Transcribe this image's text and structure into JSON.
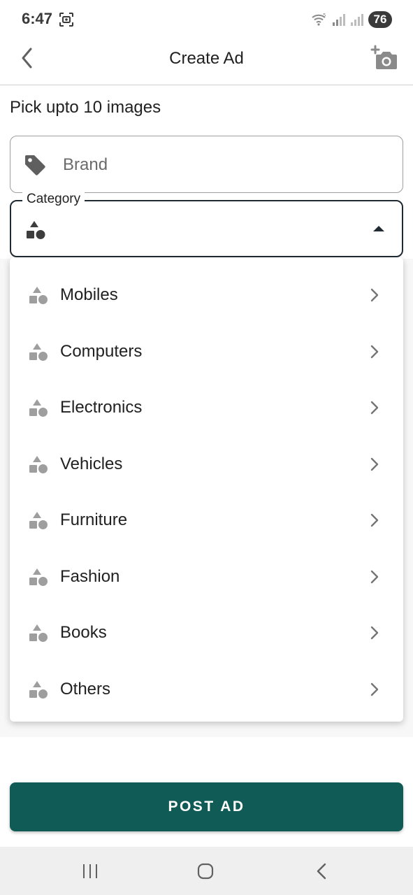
{
  "status_bar": {
    "time": "6:47",
    "battery": "76",
    "icons": [
      "screenshot-icon",
      "wifi-icon",
      "signal-icon",
      "signal-icon",
      "battery-icon"
    ]
  },
  "app_bar": {
    "title": "Create Ad",
    "back_icon": "chevron-left-icon",
    "action_icon": "add-photo-icon"
  },
  "images": {
    "label": "Pick upto 10 images"
  },
  "brand": {
    "placeholder": "Brand",
    "icon": "tag-icon"
  },
  "category": {
    "label": "Category",
    "value": "",
    "icon": "category-shapes-icon",
    "expanded": true,
    "options": [
      {
        "label": "Mobiles"
      },
      {
        "label": "Computers"
      },
      {
        "label": "Electronics"
      },
      {
        "label": "Vehicles"
      },
      {
        "label": "Furniture"
      },
      {
        "label": "Fashion"
      },
      {
        "label": "Books"
      },
      {
        "label": "Others"
      }
    ]
  },
  "post_button": {
    "label": "POST AD"
  },
  "colors": {
    "primary": "#105b55",
    "focus_border": "#1f2a33",
    "icon_gray": "#9e9e9e"
  }
}
